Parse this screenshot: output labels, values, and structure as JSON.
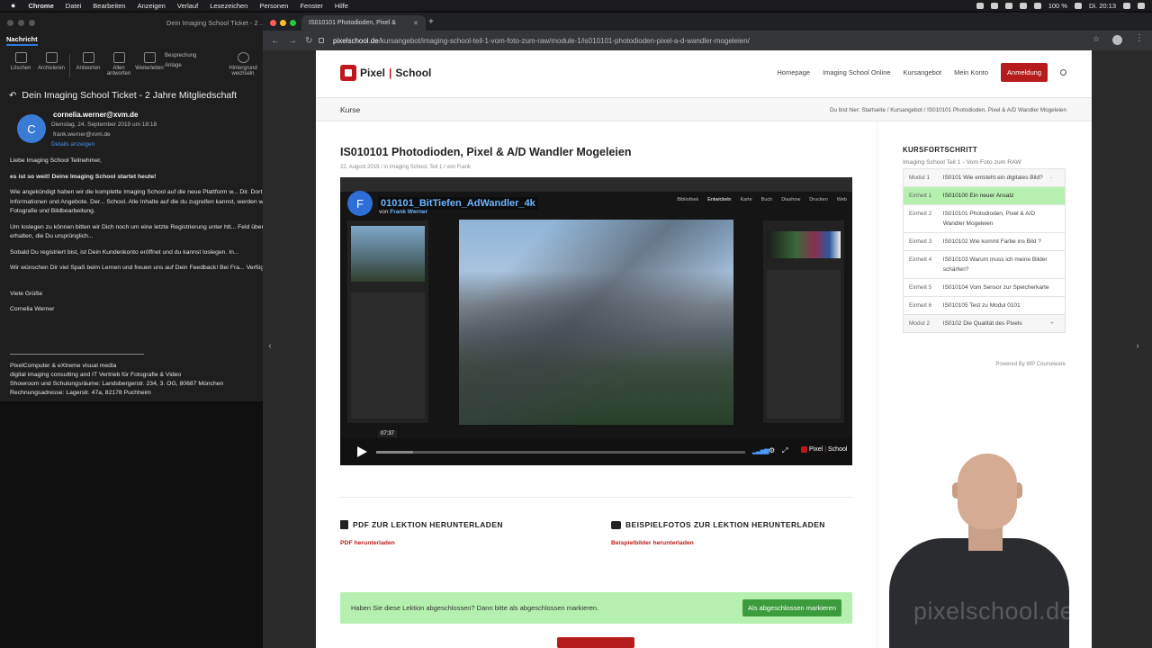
{
  "menubar": {
    "app": "Chrome",
    "items": [
      "Datei",
      "Bearbeiten",
      "Anzeigen",
      "Verlauf",
      "Lesezeichen",
      "Personen",
      "Fenster",
      "Hilfe"
    ],
    "battery": "100 %",
    "clock": "Di. 20:13"
  },
  "mail": {
    "window_title": "Dein Imaging School Ticket - 2 ...",
    "tab": "Nachricht",
    "toolbar": {
      "delete": "Löschen",
      "archive": "Archivieren",
      "reply": "Antworten",
      "reply_all": "Allen antworten",
      "forward": "Weiterleiten",
      "meeting": "Besprechung",
      "attachment": "Anlage",
      "background": "Hintergrund wechseln"
    },
    "subject": "Dein Imaging School Ticket - 2 Jahre Mitgliedschaft",
    "avatar_letter": "C",
    "from": "cornelia.werner@xvm.de",
    "date": "Dienstag, 24. September 2019 um 18:18",
    "to": "frank.werner@xvm.de",
    "details": "Details anzeigen",
    "body": [
      "Liebe Imaging School Teilnehmer,",
      "es ist so weit! Deine Imaging School startet heute!",
      "Wie angekündigt haben wir die komplette Imaging School auf die neue Plattform w... Dir. Dort findest Du ab sofort auch alle wichtigen Informationen und Angebote. Der... School. Alle Inhalte auf die du zugreifen kannst, werden wir nach und nach in deine... rund um die Fotografie und Bildbearbeitung.",
      "Um loslegen zu können bitten wir Dich noch um eine letzte Registrierung unter htt... Feld über Rechnungsdetails) um die Mitgliedschaft zu erhalten, die Du ursprünglich...",
      "Sobald Du registriert bist, ist Dein Kundenkonto eröffnet und du kannst loslegen. In...",
      "Wir wünschen Dir viel Spaß beim Lernen und freuen uns auf Dein Feedback! Bei Fra... Verfügung.",
      "Viele Grüße",
      "Cornelia Werner"
    ],
    "signature": [
      "PixelComputer & eXtreme visual media",
      "digital imaging consulting and IT Vertrieb für Fotografie & Video",
      "Showroom und Schulungsräume: Landsbergerstr. 234, 3. OG, 80687 München",
      "Rechnungsadresse: Lagerstr. 47a, 82178 Puchheim"
    ]
  },
  "browser": {
    "tab_title": "IS010101 Photodioden, Pixel &",
    "url_domain": "pixelschool.de",
    "url_path": "/kursangebot/imaging-school-teil-1-vom-foto-zum-raw/module-1/is010101-photodioden-pixel-a-d-wandler-mogeleien/"
  },
  "site": {
    "logo_a": "Pixel",
    "logo_b": "School",
    "nav": [
      "Homepage",
      "Imaging School Online",
      "Kursangebot",
      "Mein Konto"
    ],
    "cta": "Anmeldung",
    "section": "Kurse",
    "breadcrumb": "Du bist hier:  Startseite  /  Kursangebot  /  IS010101 Photodioden, Pixel & A/D Wandler Mogeleien",
    "title": "IS010101 Photodioden, Pixel & A/D Wandler Mogeleien",
    "meta": "22. August 2019  /  in Imaging School, Teil 1  /  von Frank",
    "video": {
      "avatar_letter": "F",
      "title": "010101_BitTiefen_AdWandler_4k",
      "by_prefix": "von",
      "by_name": "Frank Werner",
      "time": "07:37",
      "progress": 0.1,
      "modules": [
        "Bibliothek",
        "Entwickeln",
        "Karte",
        "Buch",
        "Diashow",
        "Drucken",
        "Web"
      ],
      "brand_a": "Pixel",
      "brand_b": "School"
    },
    "pdf_heading": "PDF ZUR LEKTION HERUNTERLADEN",
    "pdf_link": "PDF herunterladen",
    "photos_heading": "BEISPIELFOTOS ZUR LEKTION HERUNTERLADEN",
    "photos_link": "Beispielbilder herunterladen",
    "done_question": "Haben Sie diese Lektion abgeschlossen? Dann bitte als abgeschlossen markieren.",
    "done_button": "Als abgeschlossen markieren",
    "progress_heading": "KURSFORTSCHRITT",
    "progress_sub": "Imaging School Teil 1 - Vom Foto zum RAW",
    "progress_rows": [
      {
        "unit": "Modul 1",
        "title": "IS0101 Wie entsteht ein digitales Bild?",
        "mark": "-"
      },
      {
        "unit": "Einheit 1",
        "title": "IS010100 Ein neuer Ansatz",
        "mark": ""
      },
      {
        "unit": "Einheit 2",
        "title": "IS010101 Photodioden, Pixel & A/D Wandler Mogeleien",
        "mark": ""
      },
      {
        "unit": "Einheit 3",
        "title": "IS010102 Wie kommt Farbe ins Bild ?",
        "mark": ""
      },
      {
        "unit": "Einheit 4",
        "title": "IS010103 Warum muss ich meine Bilder schärfen?",
        "mark": ""
      },
      {
        "unit": "Einheit 5",
        "title": "IS010104 Vom Sensor zur Speicherkarte",
        "mark": ""
      },
      {
        "unit": "Einheit 6",
        "title": "IS010105 Test zu Modul 0101",
        "mark": ""
      },
      {
        "unit": "Modul 2",
        "title": "IS0102 Die Qualität des Pixels",
        "mark": "+"
      }
    ],
    "powered": "Powered By WP Courseware"
  },
  "overlay": {
    "watermark": "pixelschool.de"
  },
  "colors": {
    "brand_red": "#b71c1c",
    "done_green": "#b6f0b0",
    "done_button": "#3c9c3c",
    "video_title": "#6cb4ff"
  }
}
